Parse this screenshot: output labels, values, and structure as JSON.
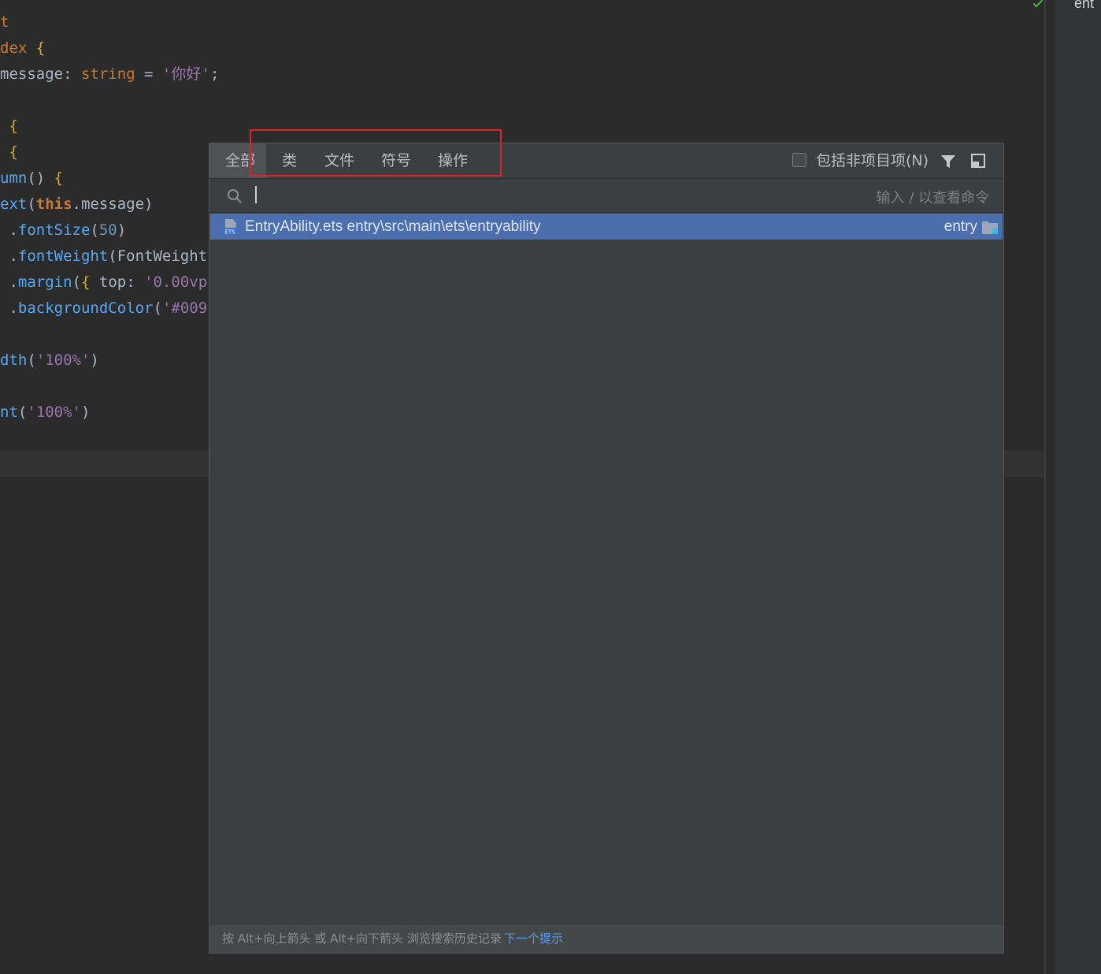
{
  "editor": {
    "lines": [
      {
        "t": "t"
      },
      {
        "t": "dex {"
      },
      {
        "t": "message: string = '你好';"
      },
      {
        "t": ""
      },
      {
        "t": " {"
      },
      {
        "t": " {"
      },
      {
        "t": "umn() {"
      },
      {
        "t": "ext(this.message)"
      },
      {
        "t": " .fontSize(50)"
      },
      {
        "t": " .fontWeight(FontWeight"
      },
      {
        "t": " .margin({ top: '0.00vp"
      },
      {
        "t": " .backgroundColor('#009"
      },
      {
        "t": ""
      },
      {
        "t": "dth('100%')"
      },
      {
        "t": ""
      },
      {
        "t": "nt('100%')"
      }
    ],
    "right_panel_label": "ent"
  },
  "popup": {
    "tabs": [
      {
        "label": "全部"
      },
      {
        "label": "类"
      },
      {
        "label": "文件"
      },
      {
        "label": "符号"
      },
      {
        "label": "操作"
      }
    ],
    "include_non_project_label": "包括非项目项(N)",
    "include_non_project_checked": false,
    "search": {
      "value": "",
      "hint": "输入 / 以查看命令"
    },
    "results": [
      {
        "icon": "ets-file-icon",
        "text": "EntryAbility.ets entry\\src\\main\\ets\\entryability",
        "module": "entry"
      }
    ],
    "footer": {
      "hint": "按 Alt+向上箭头 或 Alt+向下箭头 浏览搜索历史记录",
      "link": "下一个提示"
    }
  },
  "colors": {
    "editor_bg": "#2b2b2b",
    "popup_bg": "#3c3f41",
    "selection": "#4b6eaf",
    "annotation_box": "#e0202a",
    "link": "#589df6"
  }
}
